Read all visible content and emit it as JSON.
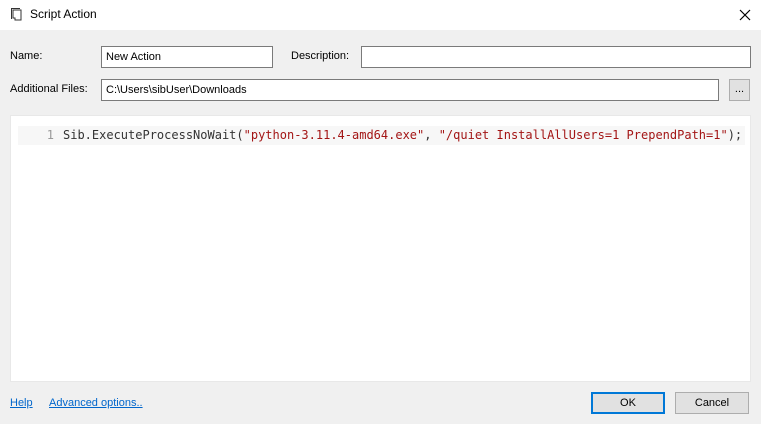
{
  "window": {
    "title": "Script Action",
    "close_glyph": "✕"
  },
  "form": {
    "name_label": "Name:",
    "name_value": "New Action",
    "description_label": "Description:",
    "description_value": "",
    "files_label": "Additional Files:",
    "files_value": "C:\\Users\\sibUser\\Downloads",
    "browse_label": "..."
  },
  "editor": {
    "line_number": "1",
    "code_prefix": "Sib.ExecuteProcessNoWait(",
    "code_arg1": "\"python-3.11.4-amd64.exe\"",
    "code_sep": ", ",
    "code_arg2": "\"/quiet InstallAllUsers=1 PrependPath=1\"",
    "code_suffix": ");"
  },
  "footer": {
    "help_label": "Help",
    "advanced_label": "Advanced options..",
    "ok_label": "OK",
    "cancel_label": "Cancel"
  },
  "icons": {
    "title": "script-icon",
    "close": "close-icon"
  },
  "colors": {
    "string_literal": "#a31515",
    "link": "#0066cc",
    "default_button_border": "#0078d7"
  }
}
